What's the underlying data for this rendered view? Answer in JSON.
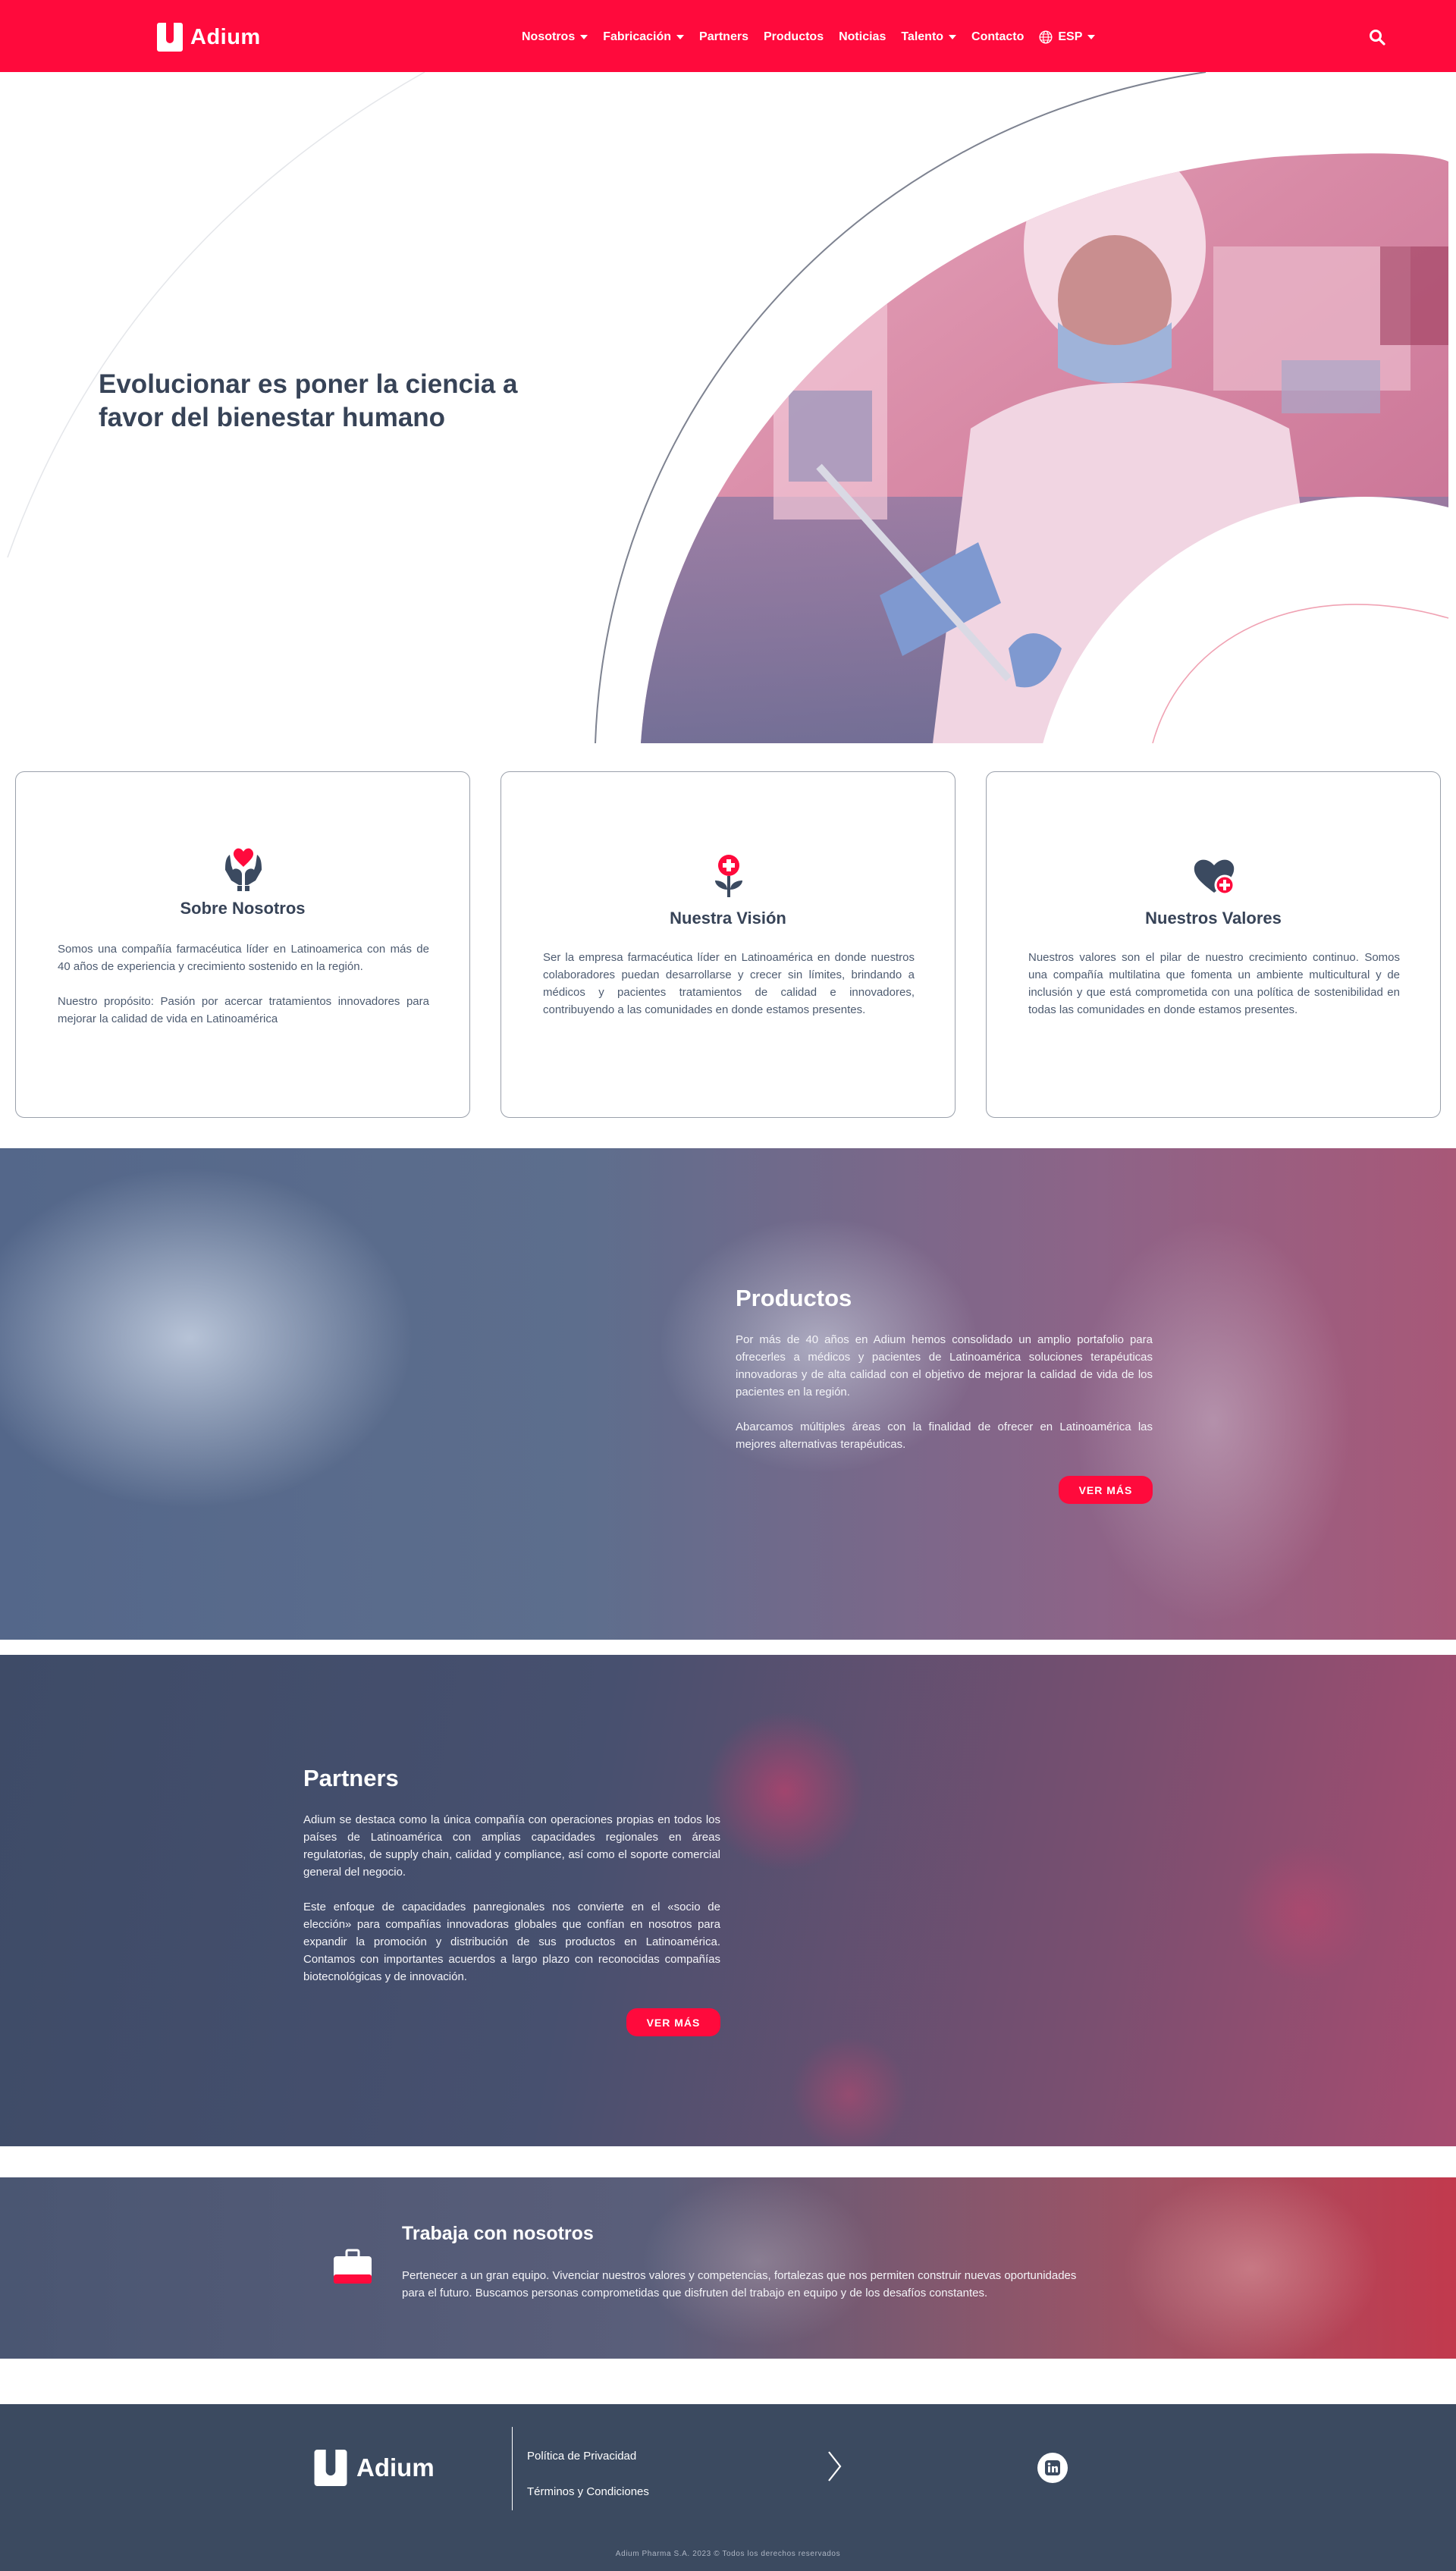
{
  "nav": {
    "brand": "Adium",
    "items": [
      {
        "label": "Nosotros",
        "dropdown": true
      },
      {
        "label": "Fabricación",
        "dropdown": true
      },
      {
        "label": "Partners",
        "dropdown": false
      },
      {
        "label": "Productos",
        "dropdown": false
      },
      {
        "label": "Noticias",
        "dropdown": false
      },
      {
        "label": "Talento",
        "dropdown": true
      },
      {
        "label": "Contacto",
        "dropdown": false
      }
    ],
    "language": "ESP",
    "icons": [
      "globe-icon",
      "search-icon"
    ]
  },
  "hero": {
    "title": "Evolucionar es poner la ciencia a favor del bienestar humano"
  },
  "cards": [
    {
      "icon": "heart-hands-icon",
      "title": "Sobre Nosotros",
      "paragraphs": [
        "Somos una compañía farmacéutica líder en Latinoamerica con más de 40 años de experiencia y crecimiento sostenido en la región.",
        "Nuestro propósito: Pasión por acercar tratamientos innovadores para mejorar la calidad de vida en Latinoamérica"
      ]
    },
    {
      "icon": "medical-flower-icon",
      "title": "Nuestra Visión",
      "paragraphs": [
        "Ser la empresa farmacéutica líder en Latinoamérica en donde nuestros colaboradores puedan desarrollarse y crecer sin límites, brindando a médicos y pacientes tratamientos de calidad e innovadores, contribuyendo a las comunidades en donde estamos presentes."
      ]
    },
    {
      "icon": "heart-plus-icon",
      "title": "Nuestros Valores",
      "paragraphs": [
        "Nuestros valores son el pilar de nuestro crecimiento continuo. Somos una compañía multilatina que fomenta un ambiente multicultural y de inclusión y que está comprometida con una política de sostenibilidad en todas las comunidades en donde estamos presentes."
      ]
    }
  ],
  "productos": {
    "title": "Productos",
    "paragraphs": [
      "Por más de 40 años en Adium hemos consolidado un amplio portafolio para ofrecerles a médicos y pacientes de Latinoamérica soluciones terapéuticas innovadoras y de alta calidad con el objetivo de mejorar la calidad de vida de los pacientes en la región.",
      "Abarcamos múltiples áreas con la finalidad de ofrecer en Latinoamérica las mejores alternativas terapéuticas."
    ],
    "button": "VER MÁS"
  },
  "partners": {
    "title": "Partners",
    "paragraphs": [
      "Adium se destaca como la única compañía con operaciones propias en todos los países de Latinoamérica con amplias capacidades regionales en áreas regulatorias, de supply chain, calidad y compliance, así como el soporte comercial general del negocio.",
      "Este enfoque de capacidades panregionales nos convierte en el «socio de elección» para compañías innovadoras globales que confían en nosotros para expandir la promoción y distribución de sus productos en Latinoamérica. Contamos con importantes acuerdos a largo plazo con reconocidas compañías biotecnológicas y de innovación."
    ],
    "button": "VER MÁS"
  },
  "trabaja": {
    "icon": "briefcase-icon",
    "title": "Trabaja con nosotros",
    "text": "Pertenecer a un gran equipo. Vivenciar nuestros valores y competencias, fortalezas que nos permiten construir nuevas oportunidades para el futuro. Buscamos personas comprometidas que disfruten del trabajo en equipo y de los desafíos constantes."
  },
  "footer": {
    "brand": "Adium",
    "links": [
      "Política de Privacidad",
      "Términos y Condiciones"
    ],
    "social": [
      "linkedin-icon"
    ],
    "copyright": "Adium Pharma S.A. 2023 © Todos los derechos reservados"
  },
  "colors": {
    "brand_red": "#ff0a3c",
    "navy": "#374357",
    "footer_bg": "#3b4a60"
  }
}
